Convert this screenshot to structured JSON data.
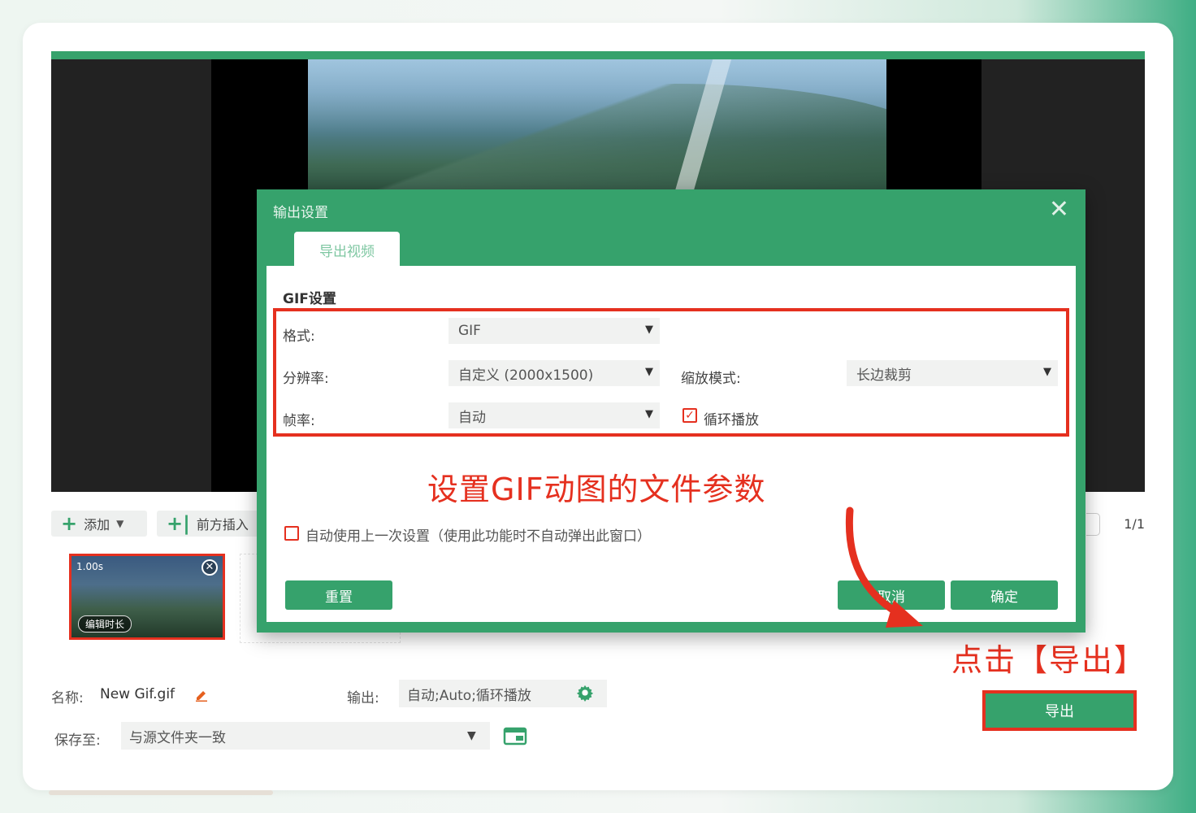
{
  "colors": {
    "accent": "#36a26c",
    "highlight": "#e5301f"
  },
  "timeline": {
    "add_label": "添加",
    "insert_before_label": "前方插入",
    "page_count": "1/1",
    "clip": {
      "duration": "1.00s",
      "edit_label": "编辑时长"
    }
  },
  "footer": {
    "name_label": "名称:",
    "name_value": "New Gif.gif",
    "output_label": "输出:",
    "output_value": "自动;Auto;循环播放",
    "save_label": "保存至:",
    "save_value": "与源文件夹一致",
    "export_label": "导出"
  },
  "dialog": {
    "title": "输出设置",
    "tab_label": "导出视频",
    "section_title": "GIF设置",
    "format_label": "格式:",
    "format_value": "GIF",
    "resolution_label": "分辨率:",
    "resolution_value": "自定义 (2000x1500)",
    "zoom_label": "缩放模式:",
    "zoom_value": "长边裁剪",
    "fps_label": "帧率:",
    "fps_value": "自动",
    "loop_label": "循环播放",
    "loop_checked": true,
    "auto_use_label": "自动使用上一次设置（使用此功能时不自动弹出此窗口）",
    "auto_use_checked": false,
    "reset_label": "重置",
    "cancel_label": "取消",
    "ok_label": "确定"
  },
  "annotations": {
    "dialog_callout": "设置GIF动图的文件参数",
    "export_callout": "点击【导出】"
  }
}
